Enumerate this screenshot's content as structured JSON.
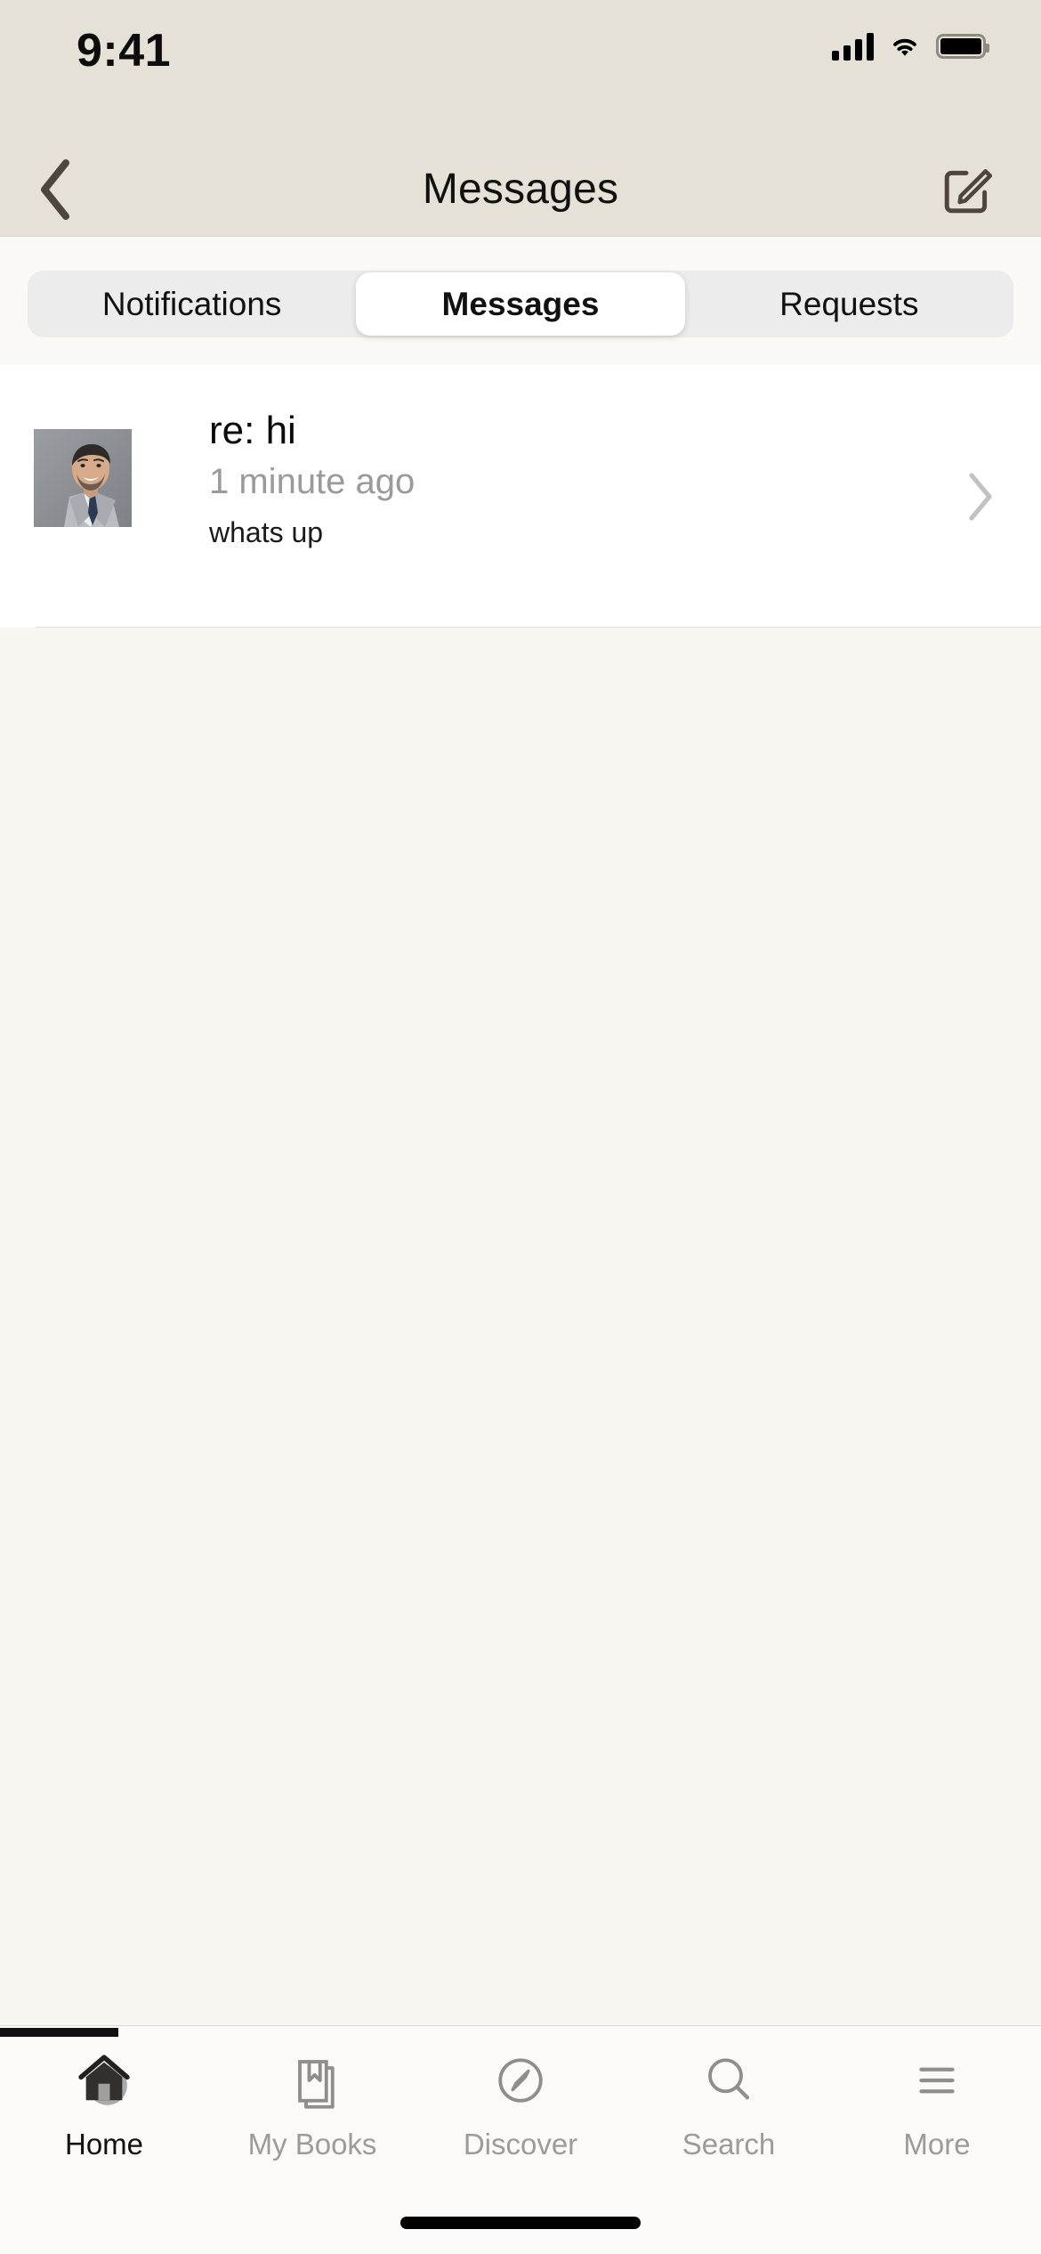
{
  "status_bar": {
    "time": "9:41",
    "signal_icon": "cellular-signal-icon",
    "wifi_icon": "wifi-icon",
    "battery_icon": "battery-full-icon"
  },
  "header": {
    "back_icon": "chevron-left-icon",
    "title": "Messages",
    "compose_icon": "compose-pencil-square-icon",
    "background_color": "#e5e1d6",
    "icon_color": "#4e463c"
  },
  "segmented_control": {
    "selected": "Messages",
    "tabs": [
      {
        "label": "Notifications",
        "selected": false
      },
      {
        "label": "Messages",
        "selected": true
      },
      {
        "label": "Requests",
        "selected": false
      }
    ],
    "track_color": "#ececec",
    "active_pill_color": "#ffffff"
  },
  "messages": {
    "items": [
      {
        "avatar_alt": "man-in-gray-suit-photo",
        "title": "re: hi",
        "time": "1 minute ago",
        "preview": "whats up",
        "chevron_icon": "chevron-right-icon"
      }
    ]
  },
  "tab_bar": {
    "items": [
      {
        "label": "Home",
        "icon": "home-icon",
        "active": true
      },
      {
        "label": "My Books",
        "icon": "books-bookmark-icon",
        "active": false
      },
      {
        "label": "Discover",
        "icon": "compass-icon",
        "active": false
      },
      {
        "label": "Search",
        "icon": "magnifier-icon",
        "active": false
      },
      {
        "label": "More",
        "icon": "hamburger-menu-icon",
        "active": false
      }
    ],
    "active_color": "#111111",
    "inactive_color": "#9b9b9b"
  },
  "colors": {
    "header_bg": "#e5e1d6",
    "page_bg": "#f7f6f1",
    "list_bg": "#ffffff"
  }
}
